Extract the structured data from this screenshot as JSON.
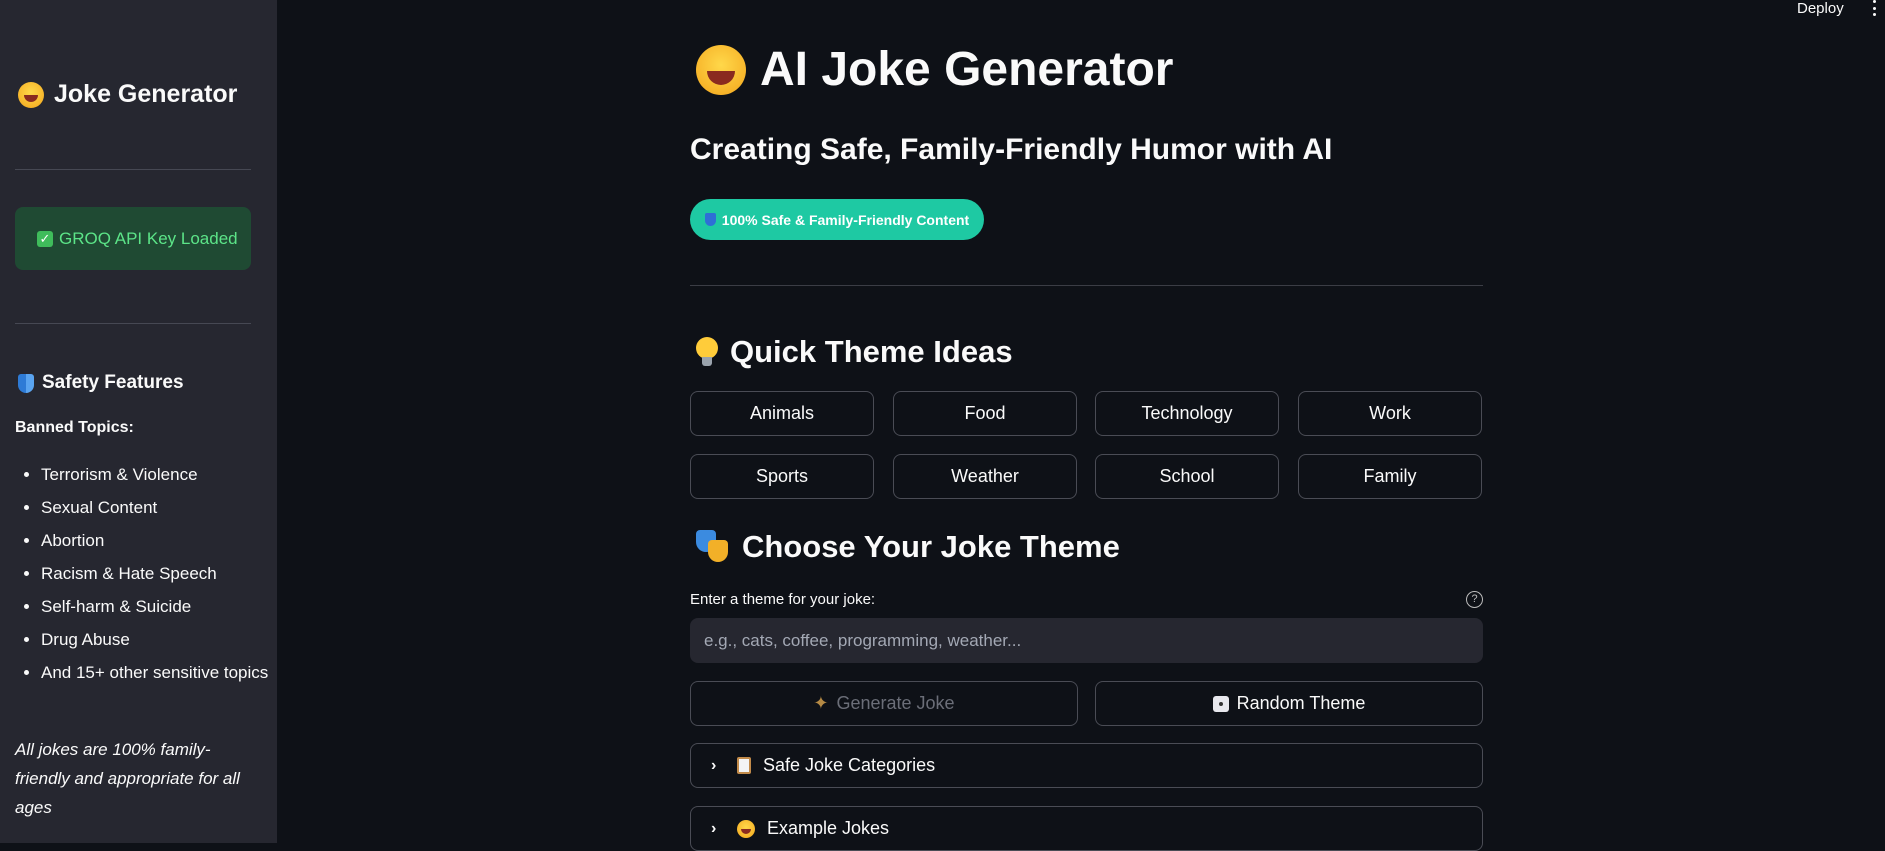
{
  "header": {
    "deploy_label": "Deploy"
  },
  "sidebar": {
    "title": "Joke Generator",
    "api_status": "GROQ API Key Loaded",
    "safety_heading": "Safety Features",
    "banned_heading": "Banned Topics:",
    "banned_topics": [
      "Terrorism & Violence",
      "Sexual Content",
      "Abortion",
      "Racism & Hate Speech",
      "Self-harm & Suicide",
      "Drug Abuse",
      "And 15+ other sensitive topics"
    ],
    "note": "All jokes are 100% family-friendly and appropriate for all ages"
  },
  "main": {
    "title": "AI Joke Generator",
    "subtitle": "Creating Safe, Family-Friendly Humor with AI",
    "safe_badge": "100% Safe & Family-Friendly Content",
    "quick_heading": "Quick Theme Ideas",
    "themes": [
      "Animals",
      "Food",
      "Technology",
      "Work",
      "Sports",
      "Weather",
      "School",
      "Family"
    ],
    "choose_heading": "Choose Your Joke Theme",
    "input_label": "Enter a theme for your joke:",
    "input_placeholder": "e.g., cats, coffee, programming, weather...",
    "input_value": "",
    "generate_label": "Generate Joke",
    "random_label": "Random Theme",
    "expanders": [
      "Safe Joke Categories",
      "Example Jokes"
    ]
  },
  "colors": {
    "accent": "#1ec9a3",
    "sidebar_bg": "#262730",
    "app_bg": "#0e1117",
    "success_text": "#5ce488"
  },
  "icons": [
    "laughing-emoji-icon",
    "check-icon",
    "shield-icon",
    "bulb-icon",
    "masks-icon",
    "help-icon",
    "sparkle-icon",
    "dice-icon",
    "chevron-right-icon",
    "clipboard-icon",
    "menu-icon"
  ]
}
